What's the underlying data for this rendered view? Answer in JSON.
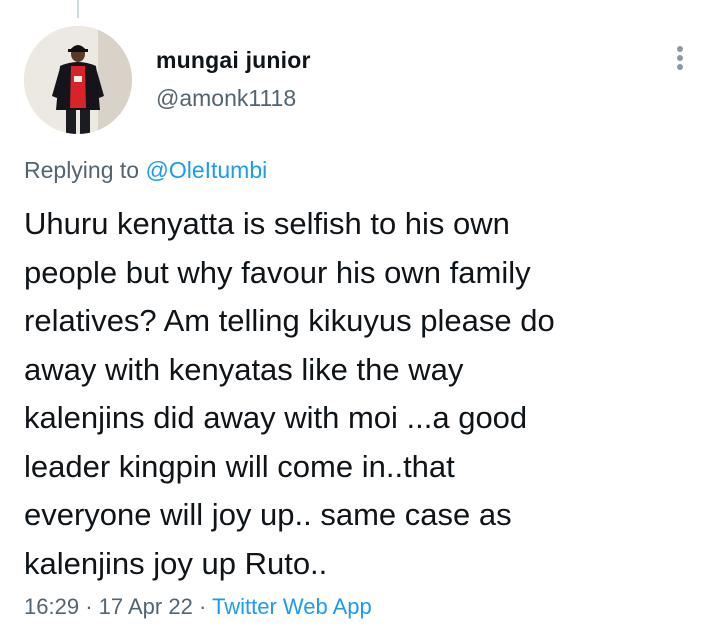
{
  "author": {
    "display_name": "mungai junior",
    "handle": "@amonk1118",
    "avatar_icon": "profile-photo"
  },
  "menu": {
    "icon": "more-options-icon"
  },
  "reply": {
    "prefix": "Replying to",
    "mention": "@OleItumbi"
  },
  "tweet": {
    "lines": [
      "Uhuru kenyatta is selfish to his own",
      "people but why favour his own family",
      "relatives? Am telling kikuyus please do",
      "away with kenyatas like the way",
      "kalenjins did away with moi ...a good",
      "leader kingpin will come in..that",
      "everyone will joy up.. same case as",
      "kalenjins joy up Ruto.."
    ]
  },
  "meta": {
    "time": "16:29",
    "separator": "·",
    "date": "17 Apr 22",
    "source": "Twitter Web App"
  },
  "colors": {
    "text_primary": "#0f1419",
    "text_secondary": "#536471",
    "link": "#1d9bf0"
  }
}
